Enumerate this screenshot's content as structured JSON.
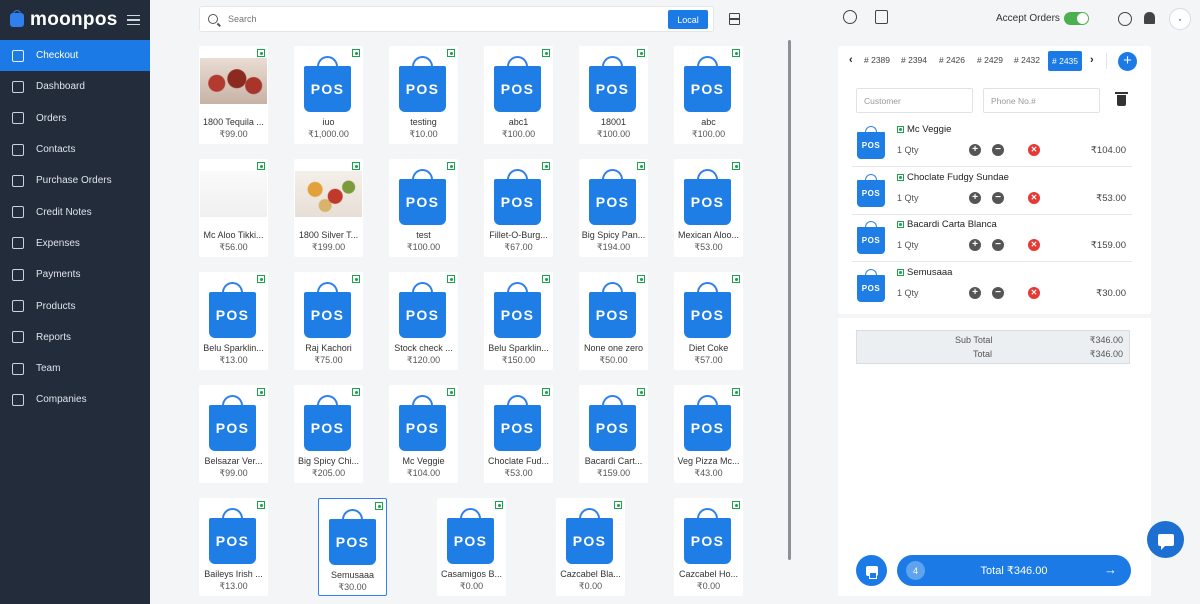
{
  "app": {
    "brand": "moonpos"
  },
  "sidebar": {
    "items": [
      {
        "label": "Checkout",
        "icon": "basket-icon",
        "active": true
      },
      {
        "label": "Dashboard",
        "icon": "home-icon"
      },
      {
        "label": "Orders",
        "icon": "orders-icon"
      },
      {
        "label": "Contacts",
        "icon": "contacts-icon"
      },
      {
        "label": "Purchase Orders",
        "icon": "cart-icon"
      },
      {
        "label": "Credit Notes",
        "icon": "credit-note-icon"
      },
      {
        "label": "Expenses",
        "icon": "wallet-icon"
      },
      {
        "label": "Payments",
        "icon": "payments-icon"
      },
      {
        "label": "Products",
        "icon": "box-icon"
      },
      {
        "label": "Reports",
        "icon": "chart-icon"
      },
      {
        "label": "Team",
        "icon": "team-icon"
      },
      {
        "label": "Companies",
        "icon": "building-icon"
      }
    ]
  },
  "search": {
    "placeholder": "Search",
    "scope_button": "Local"
  },
  "header": {
    "accept_orders_label": "Accept Orders",
    "accept_orders_on": true
  },
  "products": [
    {
      "name": "1800 Tequila ...",
      "price": "₹99.00",
      "image": "strawberry"
    },
    {
      "name": "iuo",
      "price": "₹1,000.00",
      "image": "pos"
    },
    {
      "name": "testing",
      "price": "₹10.00",
      "image": "pos"
    },
    {
      "name": "abc1",
      "price": "₹100.00",
      "image": "pos"
    },
    {
      "name": "18001",
      "price": "₹100.00",
      "image": "pos"
    },
    {
      "name": "abc",
      "price": "₹100.00",
      "image": "pos"
    },
    {
      "name": "Mc Aloo Tikki...",
      "price": "₹56.00",
      "image": "blank"
    },
    {
      "name": "1800 Silver T...",
      "price": "₹199.00",
      "image": "food"
    },
    {
      "name": "test",
      "price": "₹100.00",
      "image": "pos"
    },
    {
      "name": "Fillet-O-Burg...",
      "price": "₹67.00",
      "image": "pos"
    },
    {
      "name": "Big Spicy Pan...",
      "price": "₹194.00",
      "image": "pos"
    },
    {
      "name": "Mexican Aloo...",
      "price": "₹53.00",
      "image": "pos"
    },
    {
      "name": "Belu Sparklin...",
      "price": "₹13.00",
      "image": "pos"
    },
    {
      "name": "Raj Kachori",
      "price": "₹75.00",
      "image": "pos"
    },
    {
      "name": "Stock check ...",
      "price": "₹120.00",
      "image": "pos"
    },
    {
      "name": "Belu Sparklin...",
      "price": "₹150.00",
      "image": "pos"
    },
    {
      "name": "None one zero",
      "price": "₹50.00",
      "image": "pos"
    },
    {
      "name": "Diet Coke",
      "price": "₹57.00",
      "image": "pos"
    },
    {
      "name": "Belsazar Ver...",
      "price": "₹99.00",
      "image": "pos"
    },
    {
      "name": "Big Spicy Chi...",
      "price": "₹205.00",
      "image": "pos"
    },
    {
      "name": "Mc Veggie",
      "price": "₹104.00",
      "image": "pos"
    },
    {
      "name": "Choclate Fud...",
      "price": "₹53.00",
      "image": "pos"
    },
    {
      "name": "Bacardi Cart...",
      "price": "₹159.00",
      "image": "pos"
    },
    {
      "name": "Veg Pizza Mc...",
      "price": "₹43.00",
      "image": "pos"
    },
    {
      "name": "Baileys Irish ...",
      "price": "₹13.00",
      "image": "pos"
    },
    {
      "name": "Semusaaa",
      "price": "₹30.00",
      "image": "pos",
      "selected": true
    },
    {
      "name": "Casamigos B...",
      "price": "₹0.00",
      "image": "pos"
    },
    {
      "name": "Cazcabel Bla...",
      "price": "₹0.00",
      "image": "pos"
    },
    {
      "name": "Cazcabel Ho...",
      "price": "₹0.00",
      "image": "pos"
    }
  ],
  "bag_label": "POS",
  "order_tabs": [
    "# 2389",
    "# 2394",
    "# 2426",
    "# 2429",
    "# 2432",
    "# 2435"
  ],
  "active_tab_index": 5,
  "customer": {
    "name_placeholder": "Customer",
    "phone_placeholder": "Phone No.#"
  },
  "cart": [
    {
      "name": "Mc Veggie",
      "qty": "1 Qty",
      "price": "₹104.00"
    },
    {
      "name": "Choclate Fudgy Sundae",
      "qty": "1 Qty",
      "price": "₹53.00"
    },
    {
      "name": "Bacardi Carta Blanca",
      "qty": "1 Qty",
      "price": "₹159.00"
    },
    {
      "name": "Semusaaa",
      "qty": "1 Qty",
      "price": "₹30.00"
    }
  ],
  "totals": {
    "subtotal_label": "Sub Total",
    "subtotal": "₹346.00",
    "total_label": "Total",
    "total": "₹346.00"
  },
  "checkout": {
    "item_count": "4",
    "label": "Total ₹346.00"
  },
  "colors": {
    "accent": "#1b7ae6",
    "sidebar": "#232c3b",
    "veg": "#1aa34a",
    "remove": "#e53935"
  }
}
